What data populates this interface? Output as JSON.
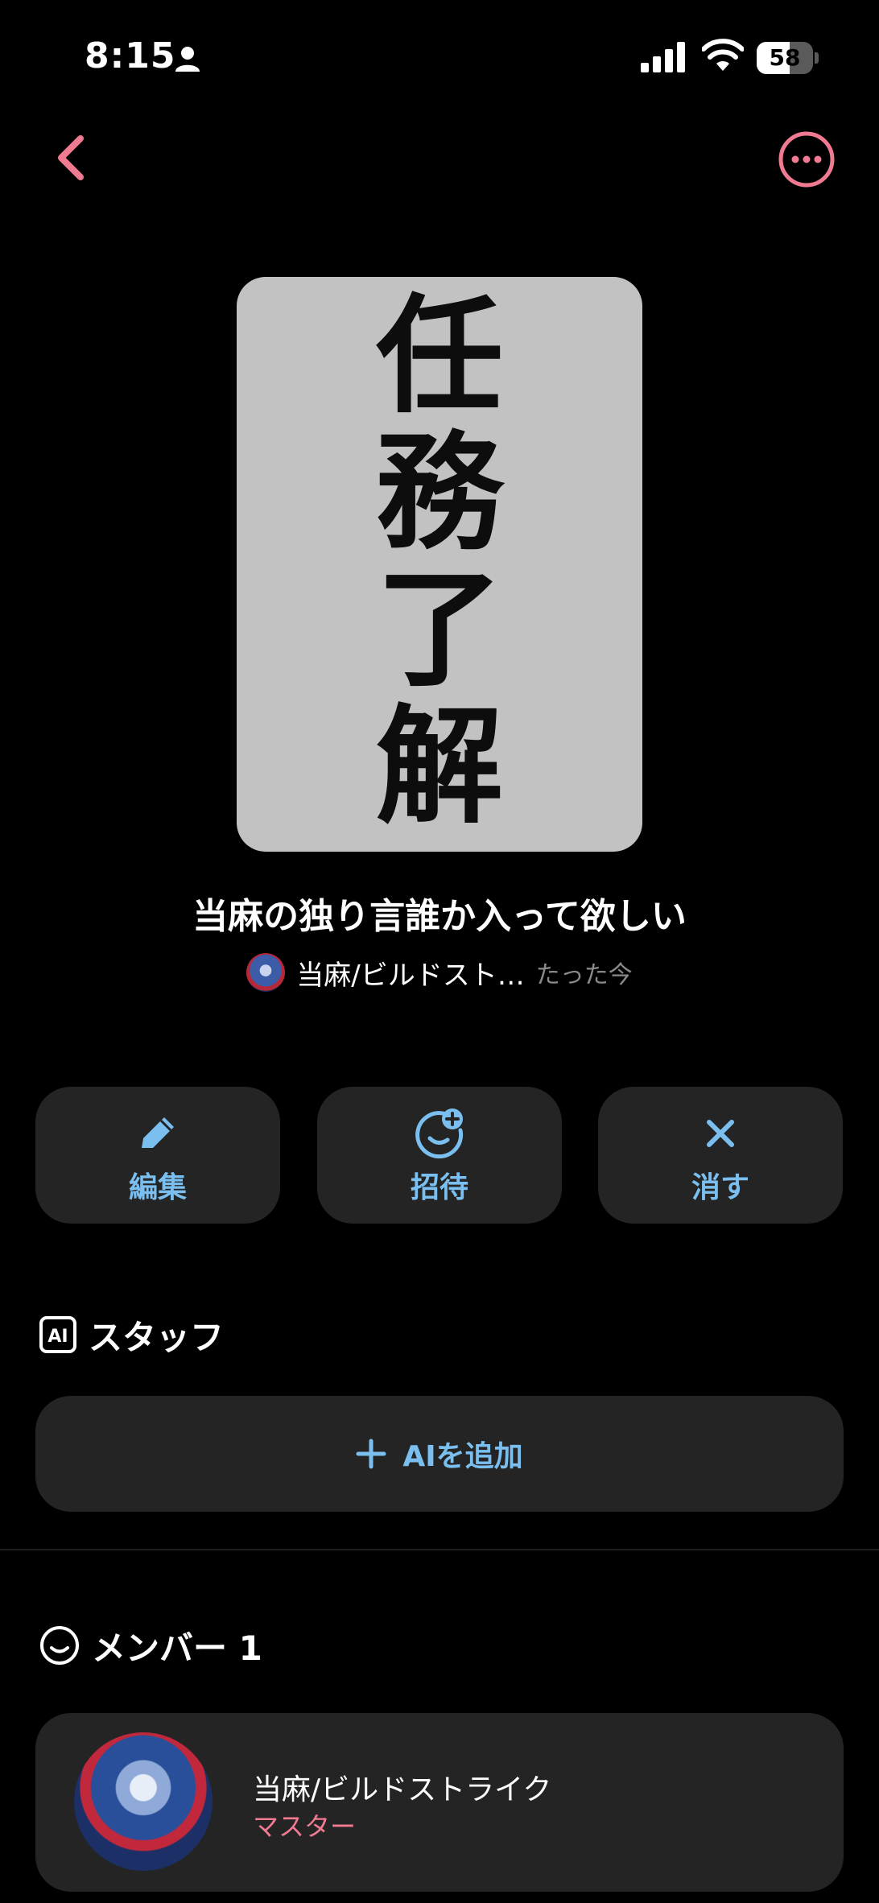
{
  "status_bar": {
    "time": "8:15",
    "battery": "58",
    "battery_level": 0.58
  },
  "header": {
    "back_icon": "chevron-left-icon",
    "more_icon": "ellipsis-circle-icon",
    "accent_color": "#f07a92"
  },
  "cover": {
    "lines": [
      "任",
      "務",
      "了",
      "解"
    ]
  },
  "room": {
    "title": "当麻の独り言誰か入って欲しい",
    "owner_name": "当麻/ビルドスト…",
    "updated": "たった今"
  },
  "actions": [
    {
      "label": "編集",
      "icon": "pencil-icon"
    },
    {
      "label": "招待",
      "icon": "add-person-icon"
    },
    {
      "label": "消す",
      "icon": "close-icon"
    }
  ],
  "staff": {
    "heading": "スタッフ",
    "badge": "AI",
    "add_label": "AIを追加"
  },
  "members": {
    "heading": "メンバー 1",
    "items": [
      {
        "name": "当麻/ビルドストライク",
        "role": "マスター"
      }
    ]
  },
  "colors": {
    "link_blue": "#7bbff0",
    "card_bg": "#242424",
    "role_pink": "#f07a92"
  }
}
